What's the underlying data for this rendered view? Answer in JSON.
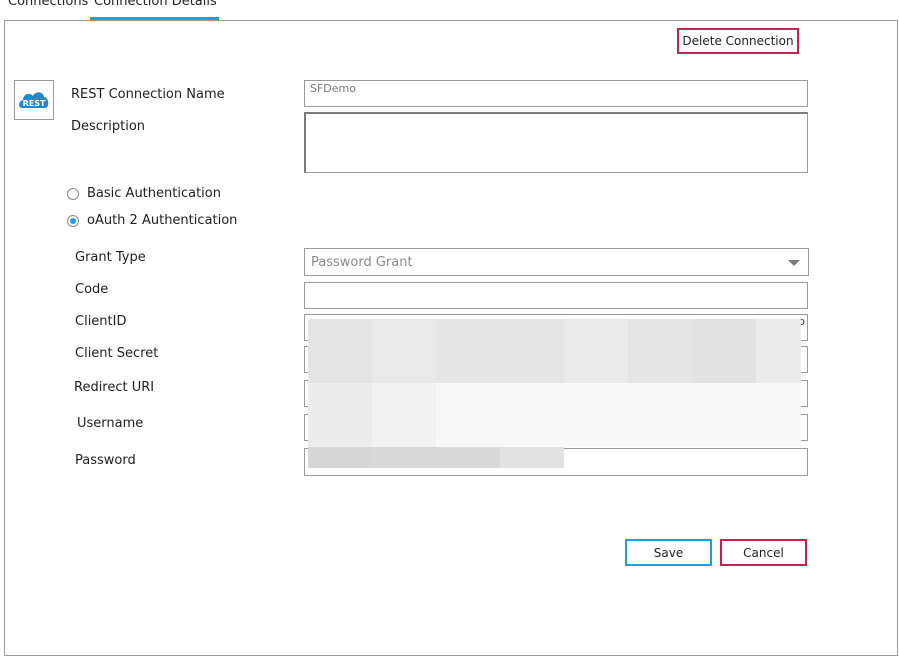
{
  "tabs": {
    "connections": "Connections",
    "details": "Connection Details"
  },
  "toolbar": {
    "delete_label": "Delete Connection"
  },
  "logo": {
    "text": "REST",
    "icon": "rest-cloud-icon",
    "color": "#1e88d4"
  },
  "form": {
    "name_label": "REST Connection Name",
    "name_value": "SFDemo",
    "description_label": "Description",
    "description_value": "",
    "auth_basic_label": "Basic Authentication",
    "auth_oauth_label": "oAuth 2 Authentication",
    "auth_selected": "oAuth 2 Authentication",
    "grant_type_label": "Grant Type",
    "grant_type_value": "Password Grant",
    "code_label": "Code",
    "code_value": "",
    "client_id_label": "ClientID",
    "client_id_tail": "p",
    "client_secret_label": "Client Secret",
    "redirect_uri_label": "Redirect URI",
    "username_label": "Username",
    "password_label": "Password"
  },
  "actions": {
    "save_label": "Save",
    "cancel_label": "Cancel"
  },
  "colors": {
    "accent": "#1ba1e2",
    "danger": "#c8214f"
  }
}
